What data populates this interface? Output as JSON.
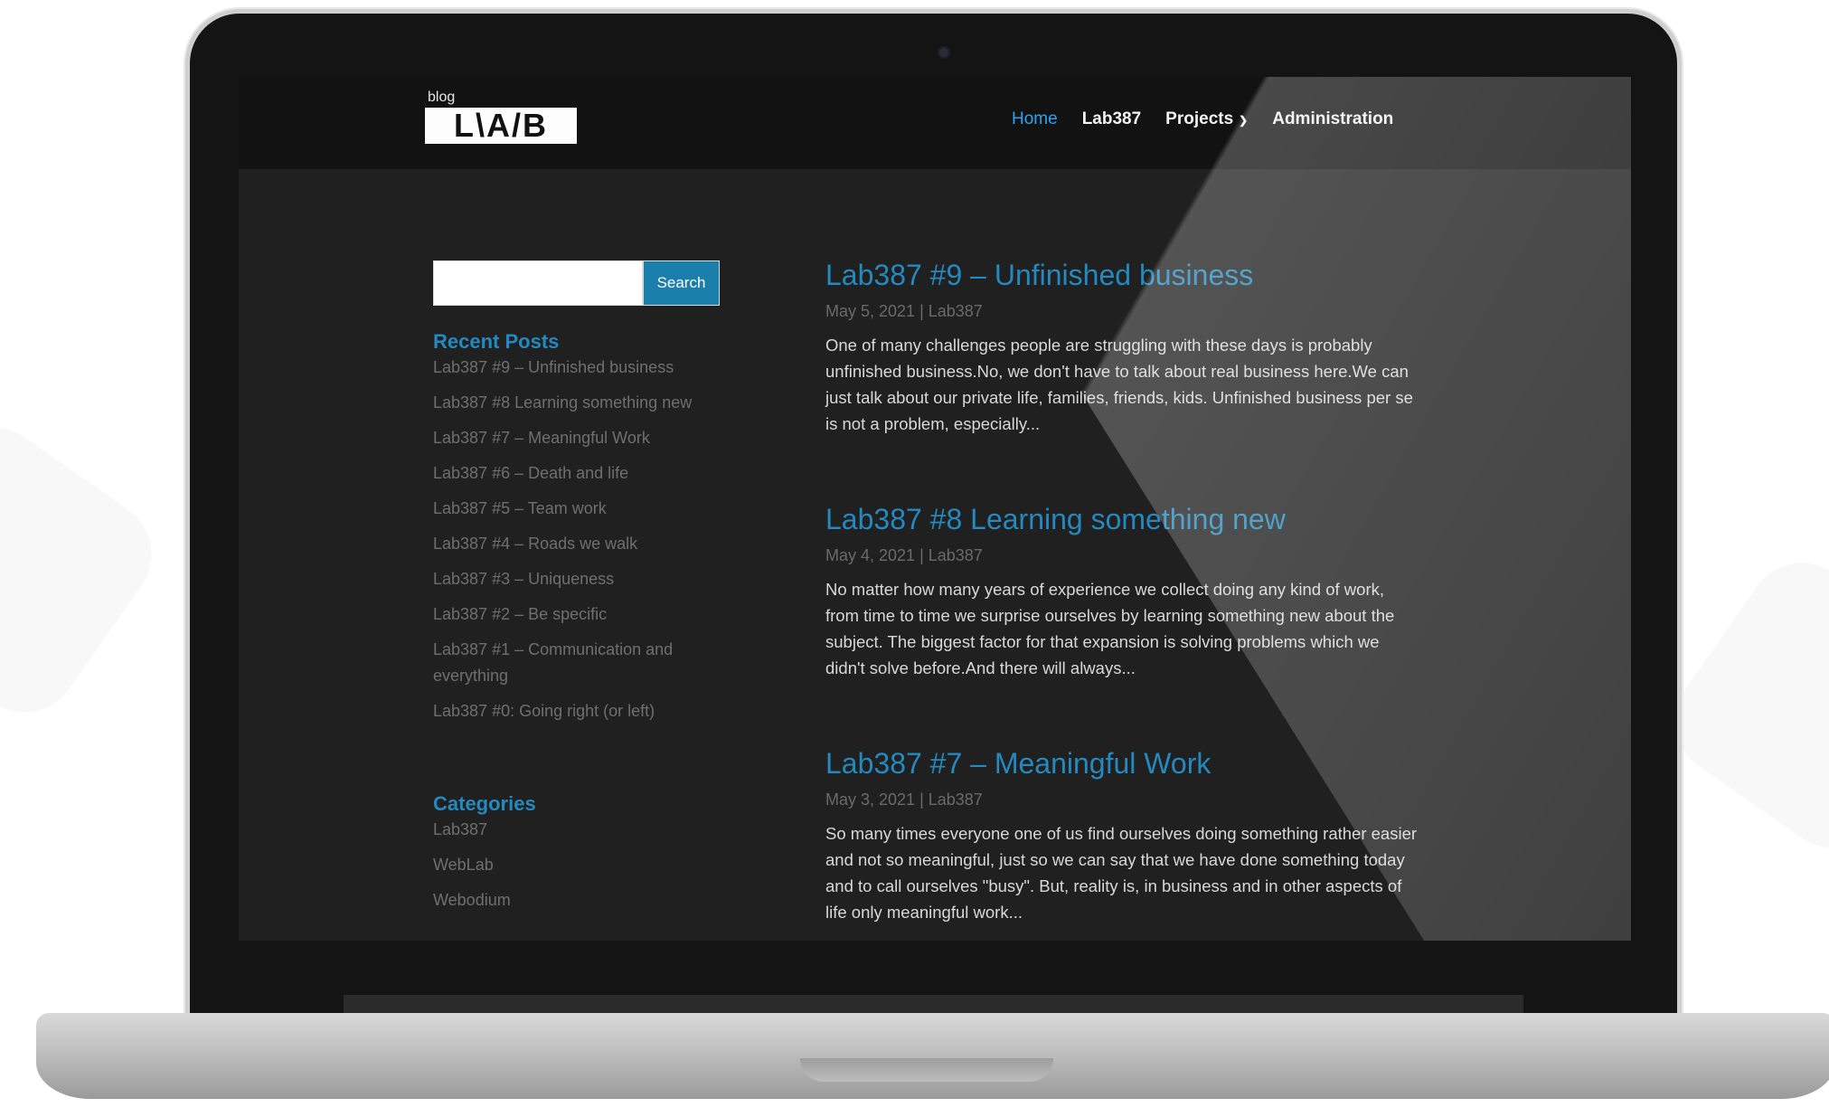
{
  "site": {
    "logo_small": "blog",
    "logo_main": "L\\A/B"
  },
  "nav": {
    "items": [
      {
        "label": "Home"
      },
      {
        "label": "Lab387"
      },
      {
        "label": "Projects"
      },
      {
        "label": "Administration"
      }
    ],
    "active": "Home"
  },
  "search": {
    "value": "",
    "button_label": "Search"
  },
  "sidebar": {
    "recent_heading": "Recent Posts",
    "recent_posts": [
      "Lab387 #9 – Unfinished business",
      "Lab387 #8 Learning something new",
      "Lab387 #7 – Meaningful Work",
      "Lab387 #6 – Death and life",
      "Lab387 #5 – Team work",
      "Lab387 #4 – Roads we walk",
      "Lab387 #3 – Uniqueness",
      "Lab387 #2 – Be specific",
      "Lab387 #1 – Communication and everything",
      "Lab387 #0: Going right (or left)"
    ],
    "categories_heading": "Categories",
    "categories": [
      "Lab387",
      "WebLab",
      "Webodium"
    ]
  },
  "posts": [
    {
      "title": "Lab387 #9 – Unfinished business",
      "meta": "May 5, 2021 | Lab387",
      "excerpt": "One of many challenges people are struggling with these days is probably unfinished business.No, we don't have to talk about real business here.We can just talk about our private life, families, friends, kids. Unfinished business per se is not a problem, especially..."
    },
    {
      "title": "Lab387 #8 Learning something new",
      "meta": "May 4, 2021 | Lab387",
      "excerpt": "No matter how many years of experience we collect doing any kind of work, from time to time we surprise ourselves by learning something new about the subject. The biggest factor for that expansion is solving problems which we didn't solve before.And there will always..."
    },
    {
      "title": "Lab387 #7 – Meaningful Work",
      "meta": "May 3, 2021 | Lab387",
      "excerpt": "So many times everyone one of us find ourselves doing something rather easier and not so meaningful, just so we can say that we have done something today and to call ourselves \"busy\". But, reality is, in business and in other aspects of life only meaningful work..."
    }
  ],
  "colors": {
    "accent": "#2489be",
    "nav_active": "#2ea3f2",
    "search_button": "#1a7fab",
    "background": "#202020"
  },
  "icons": {
    "projects_dropdown": "chevron-down-icon"
  }
}
